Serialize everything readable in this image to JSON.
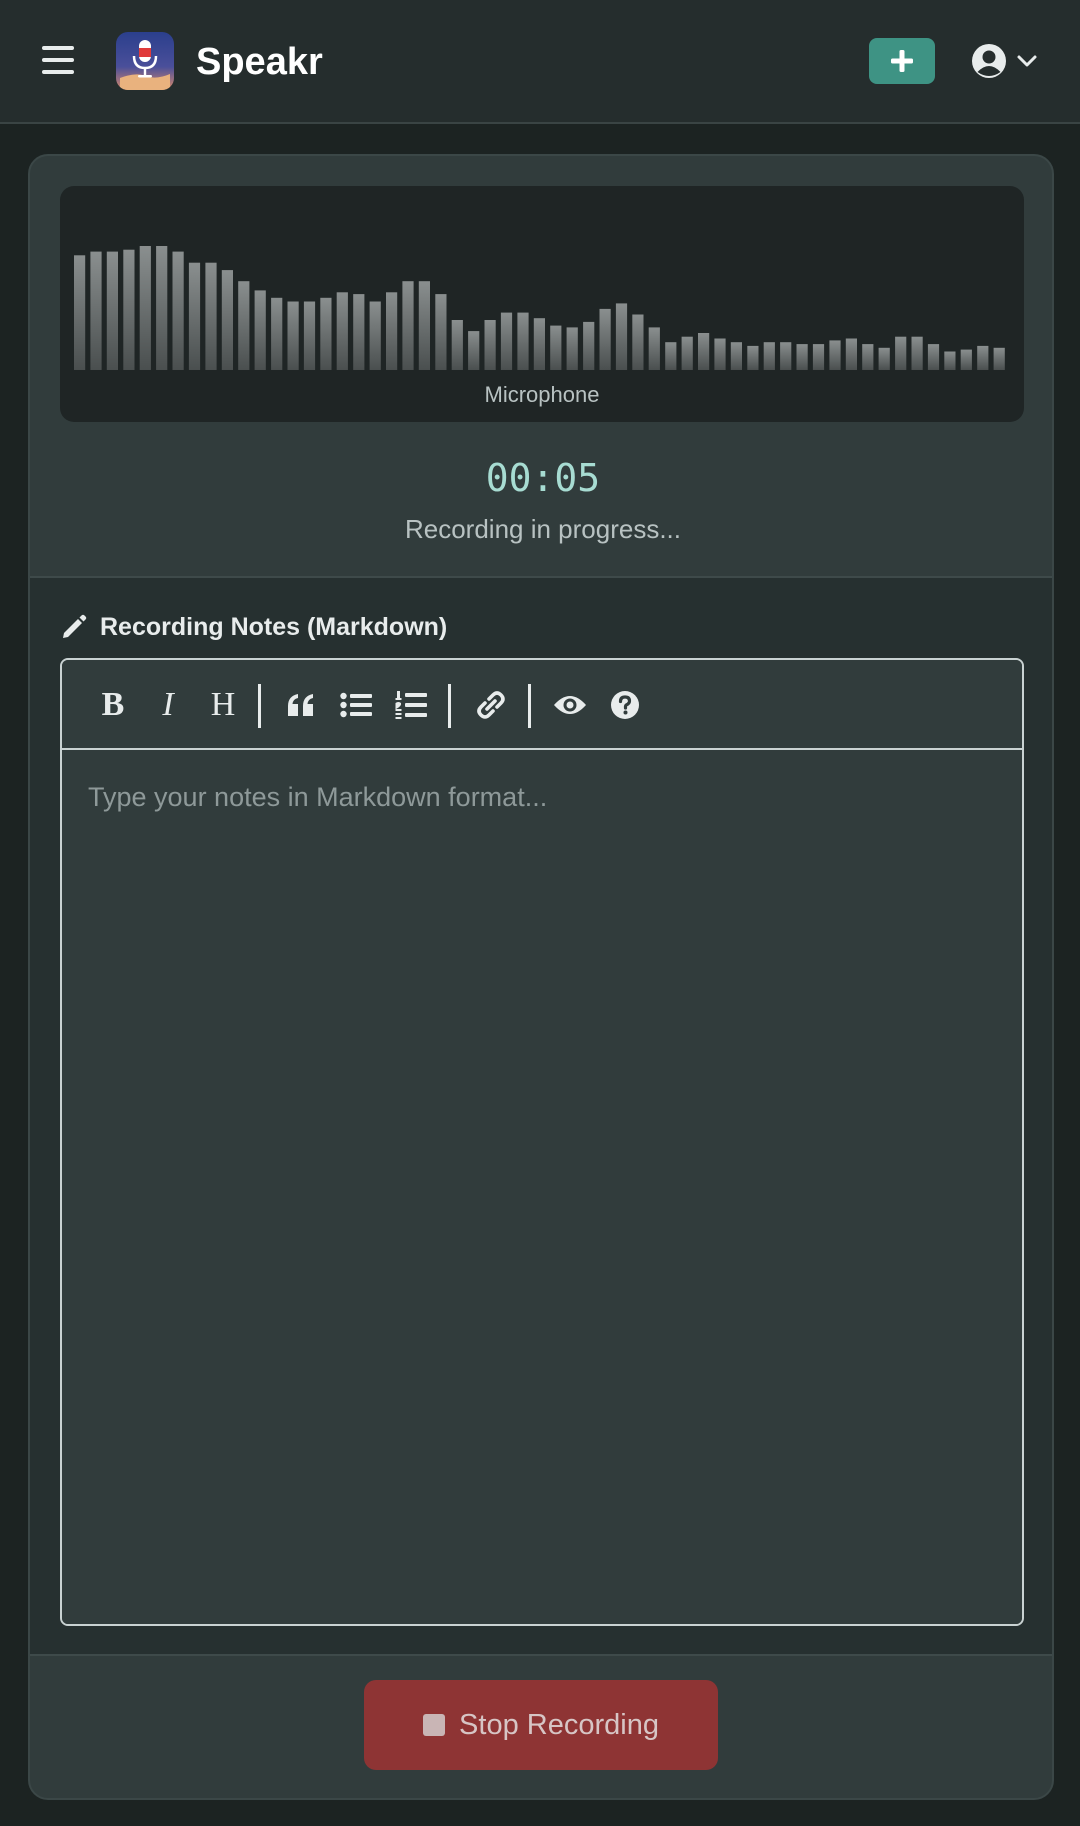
{
  "header": {
    "app_title": "Speakr",
    "menu_icon": "hamburger-icon",
    "logo_icon": "microphone-logo",
    "new_recording_icon": "plus-icon",
    "user_icon": "user-circle-icon",
    "dropdown_icon": "chevron-down-icon",
    "accent_color": "#3e9384"
  },
  "recorder": {
    "source_label": "Microphone",
    "timer": "00:05",
    "status": "Recording in progress...",
    "levels": [
      0.62,
      0.64,
      0.64,
      0.65,
      0.67,
      0.67,
      0.64,
      0.58,
      0.58,
      0.54,
      0.48,
      0.43,
      0.39,
      0.37,
      0.37,
      0.39,
      0.42,
      0.41,
      0.37,
      0.42,
      0.48,
      0.48,
      0.41,
      0.27,
      0.21,
      0.27,
      0.31,
      0.31,
      0.28,
      0.24,
      0.23,
      0.26,
      0.33,
      0.36,
      0.3,
      0.23,
      0.15,
      0.18,
      0.2,
      0.17,
      0.15,
      0.13,
      0.15,
      0.15,
      0.14,
      0.14,
      0.16,
      0.17,
      0.14,
      0.12,
      0.18,
      0.18,
      0.14,
      0.1,
      0.11,
      0.13,
      0.12
    ]
  },
  "notes": {
    "label": "Recording Notes (Markdown)",
    "label_icon": "pencil-icon",
    "placeholder": "Type your notes in Markdown format...",
    "toolbar": {
      "bold": "B",
      "italic": "I",
      "heading": "H",
      "quote_icon": "quote-icon",
      "bullet_list_icon": "bullet-list-icon",
      "numbered_list_icon": "numbered-list-icon",
      "link_icon": "link-icon",
      "preview_icon": "eye-icon",
      "help_icon": "question-circle-icon"
    }
  },
  "actions": {
    "stop_label": "Stop Recording",
    "stop_icon": "stop-icon",
    "stop_color": "#8e3434"
  }
}
